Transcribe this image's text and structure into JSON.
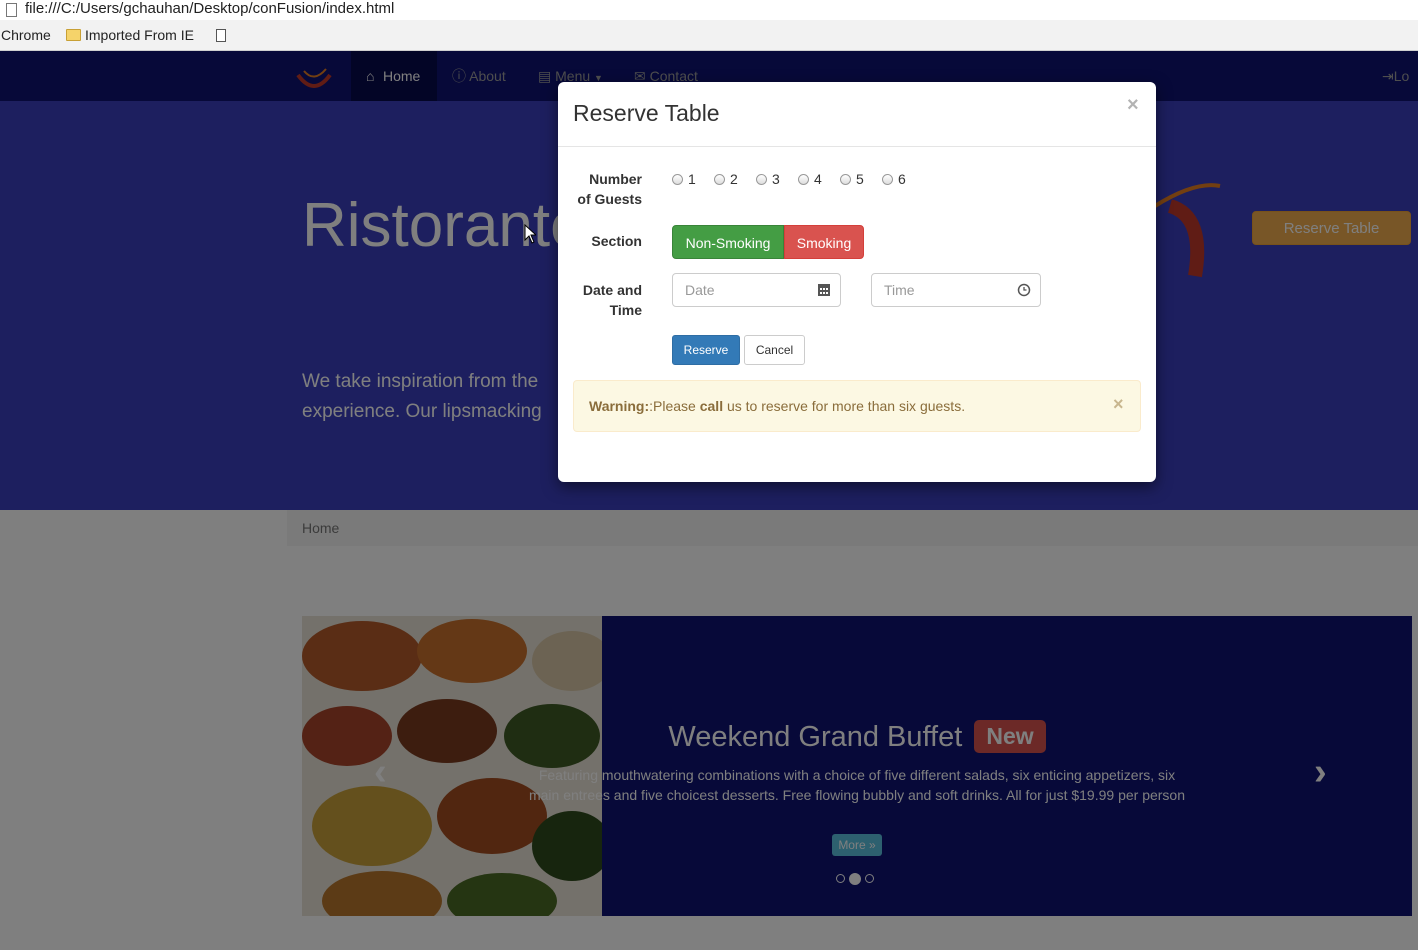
{
  "browser": {
    "url": "file:///C:/Users/gchauhan/Desktop/conFusion/index.html",
    "bookmarks": [
      "Chrome",
      "Imported From IE"
    ]
  },
  "navbar": {
    "items": [
      {
        "label": "Home",
        "icon": "home-icon"
      },
      {
        "label": "About",
        "icon": "info-icon"
      },
      {
        "label": "Menu",
        "icon": "list-icon"
      },
      {
        "label": "Contact",
        "icon": "envelope-icon"
      }
    ],
    "login_label": "Lo"
  },
  "jumbotron": {
    "title": "Ristorante",
    "text_line1": "We take inspiration from the",
    "text_line2": "experience. Our lipsmacking",
    "reserve_button": "Reserve Table"
  },
  "breadcrumb": {
    "current": "Home"
  },
  "carousel": {
    "heading": "Weekend Grand Buffet",
    "badge": "New",
    "description": "Featuring mouthwatering combinations with a choice of five different salads, six enticing appetizers, six main entrees and five choicest desserts. Free flowing bubbly and soft drinks. All for just $19.99 per person",
    "more_button": "More »",
    "active_slide": 2,
    "slide_count": 3
  },
  "modal": {
    "title": "Reserve Table",
    "close_glyph": "×",
    "guests_label_line1": "Number",
    "guests_label_line2": "of Guests",
    "guest_options": [
      "1",
      "2",
      "3",
      "4",
      "5",
      "6"
    ],
    "section_label": "Section",
    "section_options": [
      "Non-Smoking",
      "Smoking"
    ],
    "datetime_label_line1": "Date and",
    "datetime_label_line2": "Time",
    "date_placeholder": "Date",
    "time_placeholder": "Time",
    "reserve_button": "Reserve",
    "cancel_button": "Cancel",
    "alert": {
      "strong": "Warning:",
      "text_before": ":Please ",
      "call": "call",
      "text_after": " us to reserve for more than six guests.",
      "close_glyph": "×"
    }
  },
  "colors": {
    "navbar": "#0e1272",
    "jumbotron": "#3a3fbe",
    "success": "#449d44",
    "danger": "#d9534f",
    "primary": "#337ab7",
    "warning_bg": "#fcf8e3",
    "orange": "#f0ad4e"
  }
}
